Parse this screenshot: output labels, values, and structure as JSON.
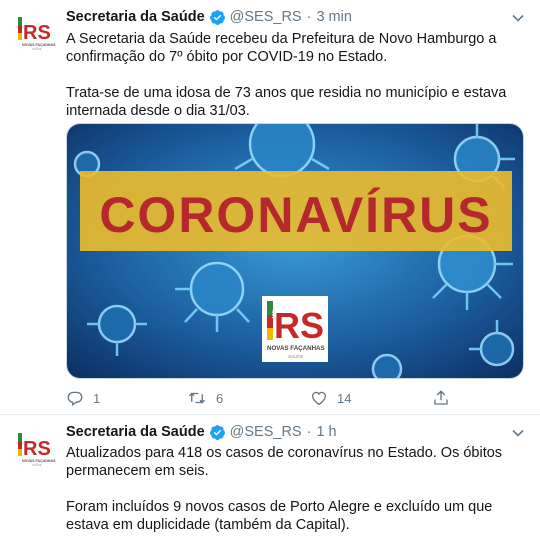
{
  "colors": {
    "text": "#14171a",
    "secondary": "#657786",
    "verified": "#1da1f2",
    "banner_yellow": "#ecbc2b",
    "banner_red": "#b5282e",
    "rs_green": "#2e8b3a",
    "rs_red": "#c62828",
    "rs_yellow": "#f2b705"
  },
  "tweets": [
    {
      "author": {
        "name": "Secretaria da Saúde",
        "handle": "@SES_RS",
        "avatar": {
          "gov": "GOV",
          "letters": "RS",
          "caption": "NOVAS FAÇANHAS",
          "subcaption": "SAÚDE"
        }
      },
      "separator": "·",
      "time": "3 min",
      "paragraphs": [
        "A Secretaria da Saúde recebeu da Prefeitura de Novo Hamburgo a confirmação do 7º óbito por COVID-19 no Estado.",
        "Trata-se de uma idosa de 73 anos que residia no município e estava internada desde o dia 31/03."
      ],
      "media": {
        "banner_text": "CORONAVÍRUS",
        "logo": {
          "gov": "GOV",
          "letters": "RS",
          "caption": "NOVAS FAÇANHAS",
          "subcaption": "SAÚDE"
        }
      },
      "actions": {
        "replies": "1",
        "retweets": "6",
        "likes": "14"
      }
    },
    {
      "author": {
        "name": "Secretaria da Saúde",
        "handle": "@SES_RS",
        "avatar": {
          "gov": "GOV",
          "letters": "RS",
          "caption": "NOVAS FAÇANHAS",
          "subcaption": "SAÚDE"
        }
      },
      "separator": "·",
      "time": "1 h",
      "paragraphs": [
        "Atualizados para 418 os casos de coronavírus no Estado. Os óbitos permanecem em seis.",
        "Foram incluídos 9 novos casos de Porto Alegre e excluído um que estava em duplicidade (também da Capital)."
      ]
    }
  ],
  "icons": {
    "verified": "verified-badge-icon",
    "caret": "chevron-down-icon",
    "reply": "reply-icon",
    "retweet": "retweet-icon",
    "like": "heart-icon",
    "share": "share-icon"
  }
}
